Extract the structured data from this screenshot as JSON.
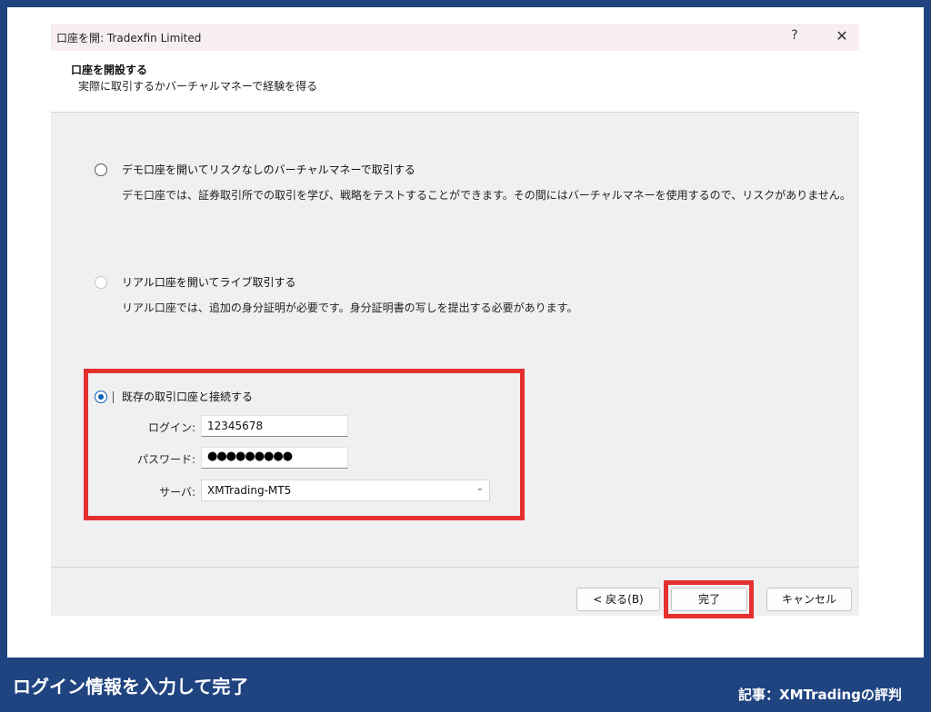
{
  "dialog": {
    "title": "口座を開: Tradexfin Limited",
    "help_label": "?",
    "close_label": "✕"
  },
  "header": {
    "title": "口座を開設する",
    "subtitle": "実際に取引するかバーチャルマネーで経験を得る"
  },
  "options": {
    "demo": {
      "label": "デモ口座を開いてリスクなしのバーチャルマネーで取引する",
      "description": "デモ口座では、証券取引所での取引を学び、戦略をテストすることができます。その間にはバーチャルマネーを使用するので、リスクがありません。",
      "selected": false
    },
    "real": {
      "label": "リアル口座を開いてライブ取引する",
      "description": "リアル口座では、追加の身分証明が必要です。身分証明書の写しを提出する必要があります。",
      "selected": false
    },
    "existing": {
      "label": "既存の取引口座と接続する",
      "selected": true
    }
  },
  "form": {
    "login_label": "ログイン:",
    "login_value": "12345678",
    "password_label": "パスワード:",
    "password_value": "●●●●●●●●●",
    "server_label": "サーバ:",
    "server_value": "XMTrading-MT5"
  },
  "buttons": {
    "back": "< 戻る(B)",
    "finish": "完了",
    "cancel": "キャンセル"
  },
  "caption": "ログイン情報を入力して完了",
  "credit": "記事：XMTradingの評判",
  "colors": {
    "background_blue": "#1f4480",
    "highlight_red": "#e53030",
    "radio_blue": "#0a5fb4"
  }
}
